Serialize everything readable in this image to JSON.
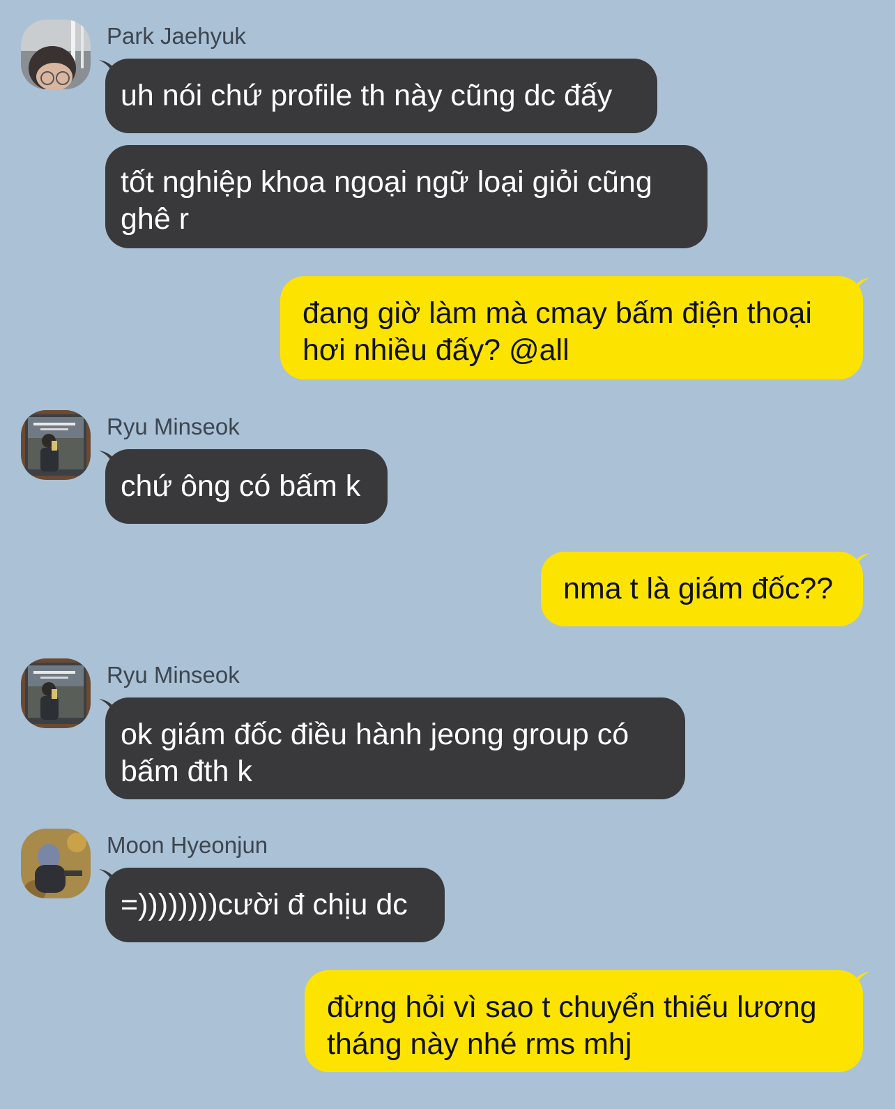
{
  "chat": {
    "colors": {
      "background": "#abc1d6",
      "incoming_bubble": "#39393c",
      "outgoing_bubble": "#fde300"
    },
    "groups": [
      {
        "sender": "Park Jaehyuk",
        "avatar_icon": "profile-photo-icon",
        "messages": [
          {
            "lines": [
              "uh nói chứ profile th này cũng dc đấy"
            ]
          },
          {
            "lines": [
              "tốt nghiệp khoa ngoại ngữ loại giỏi cũng",
              "ghê r"
            ]
          }
        ]
      },
      {
        "own": true,
        "messages": [
          {
            "lines": [
              "đang giờ làm mà cmay bấm điện thoại",
              "hơi nhiều đấy? @all"
            ]
          }
        ]
      },
      {
        "sender": "Ryu Minseok",
        "avatar_icon": "profile-photo-icon",
        "messages": [
          {
            "lines": [
              "chứ ông có bấm k"
            ]
          }
        ]
      },
      {
        "own": true,
        "messages": [
          {
            "lines": [
              "nma t là giám đốc??"
            ]
          }
        ]
      },
      {
        "sender": "Ryu Minseok",
        "avatar_icon": "profile-photo-icon",
        "messages": [
          {
            "lines": [
              "ok giám đốc điều hành jeong group có",
              "bấm đth k"
            ]
          }
        ]
      },
      {
        "sender": "Moon Hyeonjun",
        "avatar_icon": "profile-photo-icon",
        "messages": [
          {
            "lines": [
              "=))))))))cười đ chịu dc"
            ]
          }
        ]
      },
      {
        "own": true,
        "messages": [
          {
            "lines": [
              "đừng hỏi vì sao t chuyển thiếu lương",
              "tháng này nhé rms mhj"
            ]
          }
        ]
      }
    ]
  }
}
